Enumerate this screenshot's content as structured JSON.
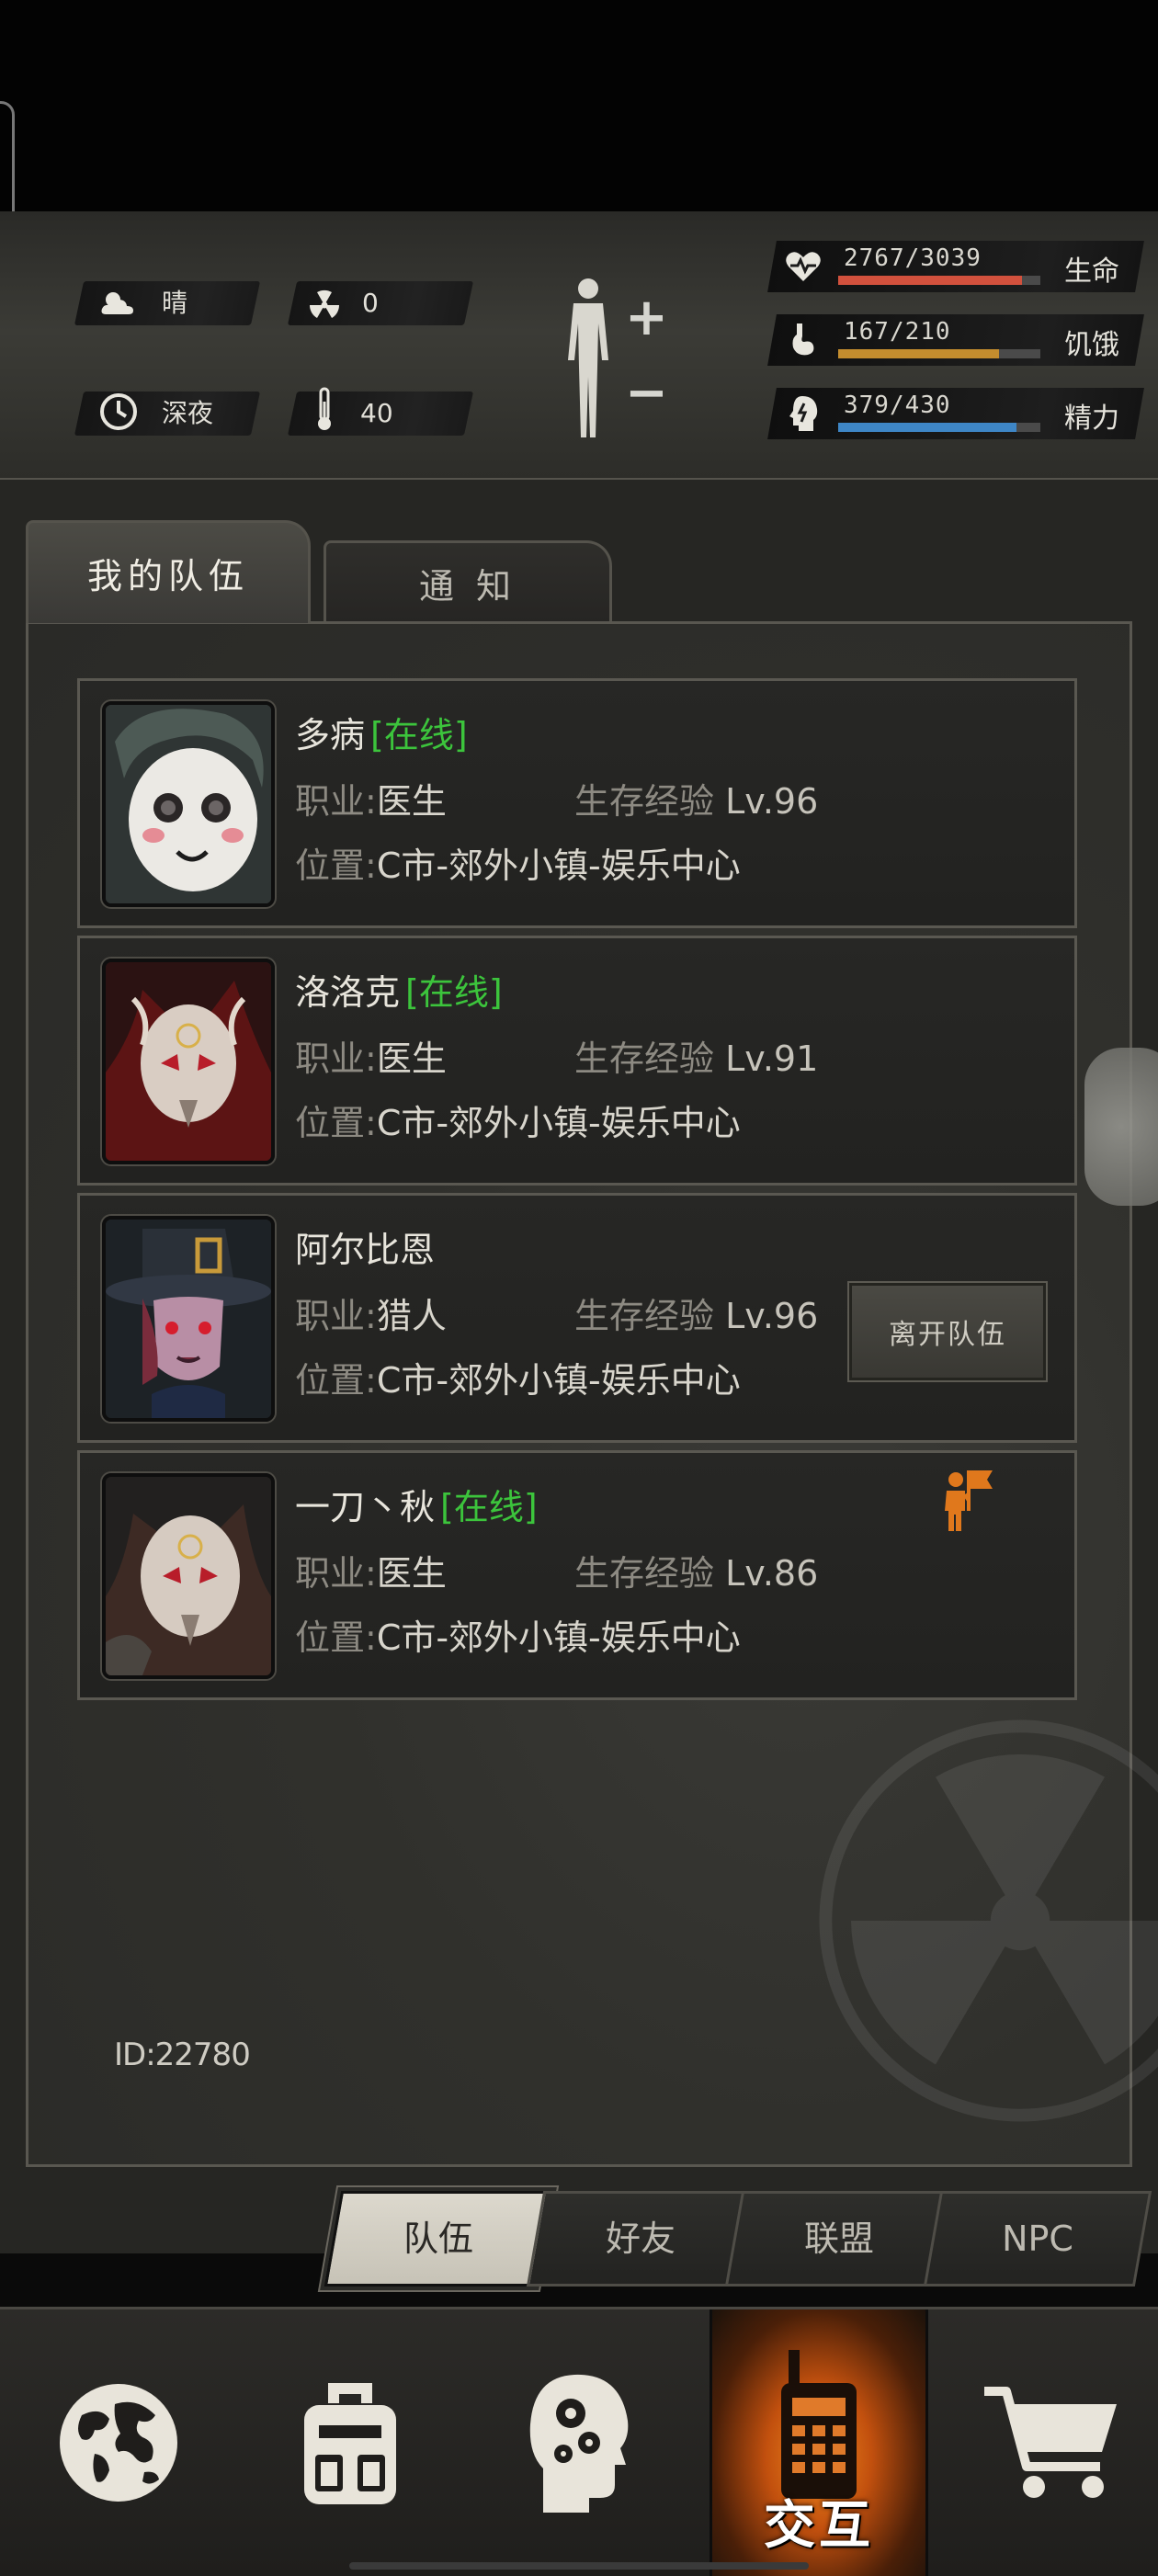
{
  "environment": {
    "weather": "晴",
    "radiation": "0",
    "time_of_day": "深夜",
    "temperature": "40"
  },
  "stats": {
    "life": {
      "value": "2767/3039",
      "label": "生命",
      "fill": 0.91,
      "color": "#d2513d"
    },
    "hunger": {
      "value": "167/210",
      "label": "饥饿",
      "fill": 0.795,
      "color": "#c48d2e"
    },
    "energy": {
      "value": "379/430",
      "label": "精力",
      "fill": 0.88,
      "color": "#3e86c6"
    }
  },
  "tabs": {
    "team": "我的队伍",
    "notice": "通 知"
  },
  "labels": {
    "job_key": "职业:",
    "exp_key": "生存经验",
    "loc_key": "位置:",
    "online": "[在线]"
  },
  "members": [
    {
      "name": "多病",
      "online": "[在线]",
      "job": "医生",
      "exp": "Lv.96",
      "location": "C市-郊外小镇-娱乐中心"
    },
    {
      "name": "洛洛克",
      "online": "[在线]",
      "job": "医生",
      "exp": "Lv.91",
      "location": "C市-郊外小镇-娱乐中心"
    },
    {
      "name": "阿尔比恩",
      "online": "",
      "job": "猎人",
      "exp": "Lv.96",
      "location": "C市-郊外小镇-娱乐中心"
    },
    {
      "name": "一刀丶秋",
      "online": "[在线]",
      "job": "医生",
      "exp": "Lv.86",
      "location": "C市-郊外小镇-娱乐中心"
    }
  ],
  "leave_button": "离开队伍",
  "player_id": "ID:22780",
  "sub_tabs": [
    "队伍",
    "好友",
    "联盟",
    "NPC"
  ],
  "nav": {
    "interact_label": "交互"
  }
}
